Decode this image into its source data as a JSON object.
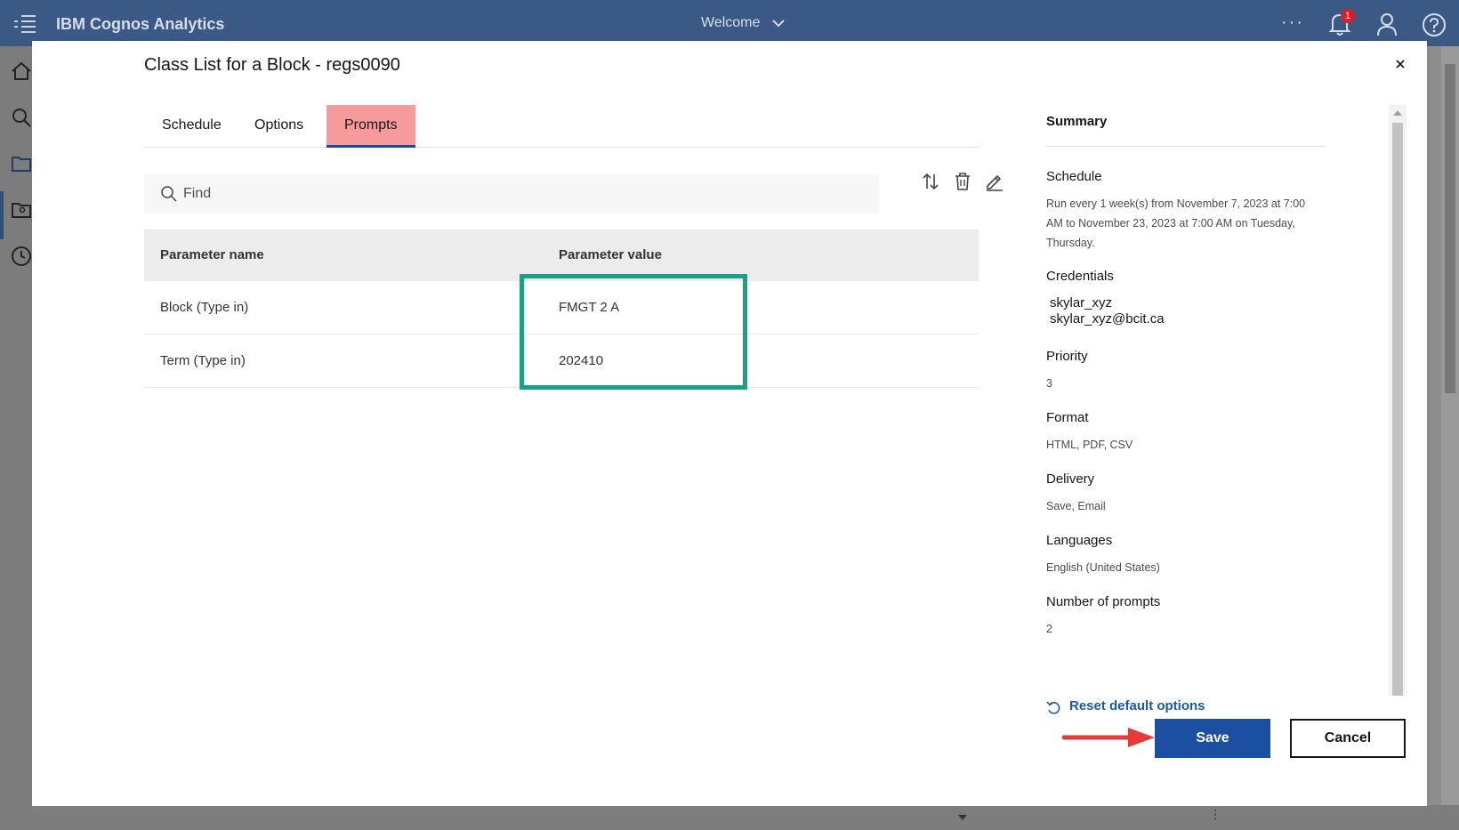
{
  "topbar": {
    "brand": "IBM Cognos Analytics",
    "welcome": "Welcome",
    "more": "···",
    "notification_count": "1"
  },
  "dialog": {
    "title": "Class List for a Block - regs0090",
    "close_label": "×",
    "tabs": [
      {
        "label": "Schedule",
        "selected": false
      },
      {
        "label": "Options",
        "selected": false
      },
      {
        "label": "Prompts",
        "selected": true
      }
    ],
    "search": {
      "placeholder": "Find",
      "value": ""
    },
    "table": {
      "headers": [
        "Parameter name",
        "Parameter value"
      ],
      "rows": [
        {
          "name": "Block (Type in)",
          "value": "FMGT 2 A"
        },
        {
          "name": "Term (Type in)",
          "value": "202410"
        }
      ]
    },
    "summary": {
      "heading": "Summary",
      "schedule_label": "Schedule",
      "schedule_value": "Run every 1 week(s) from November 7, 2023 at 7:00 AM to November 23, 2023 at 7:00 AM on Tuesday, Thursday.",
      "credentials_label": "Credentials",
      "credentials_user": "skylar_xyz",
      "credentials_email": "skylar_xyz@bcit.ca",
      "priority_label": "Priority",
      "priority_value": "3",
      "format_label": "Format",
      "format_value": "HTML, PDF, CSV",
      "delivery_label": "Delivery",
      "delivery_value": "Save, Email",
      "languages_label": "Languages",
      "languages_value": "English (United States)",
      "prompts_label": "Number of prompts",
      "prompts_value": "2",
      "reset_label": "Reset default options"
    },
    "buttons": {
      "save": "Save",
      "cancel": "Cancel"
    }
  },
  "colors": {
    "topbar": "#3a5a85",
    "accent": "#1b4f9f",
    "highlight_box": "#1aa189",
    "selected_tab_bg": "#f59b9b",
    "arrow": "#e63a3a"
  }
}
